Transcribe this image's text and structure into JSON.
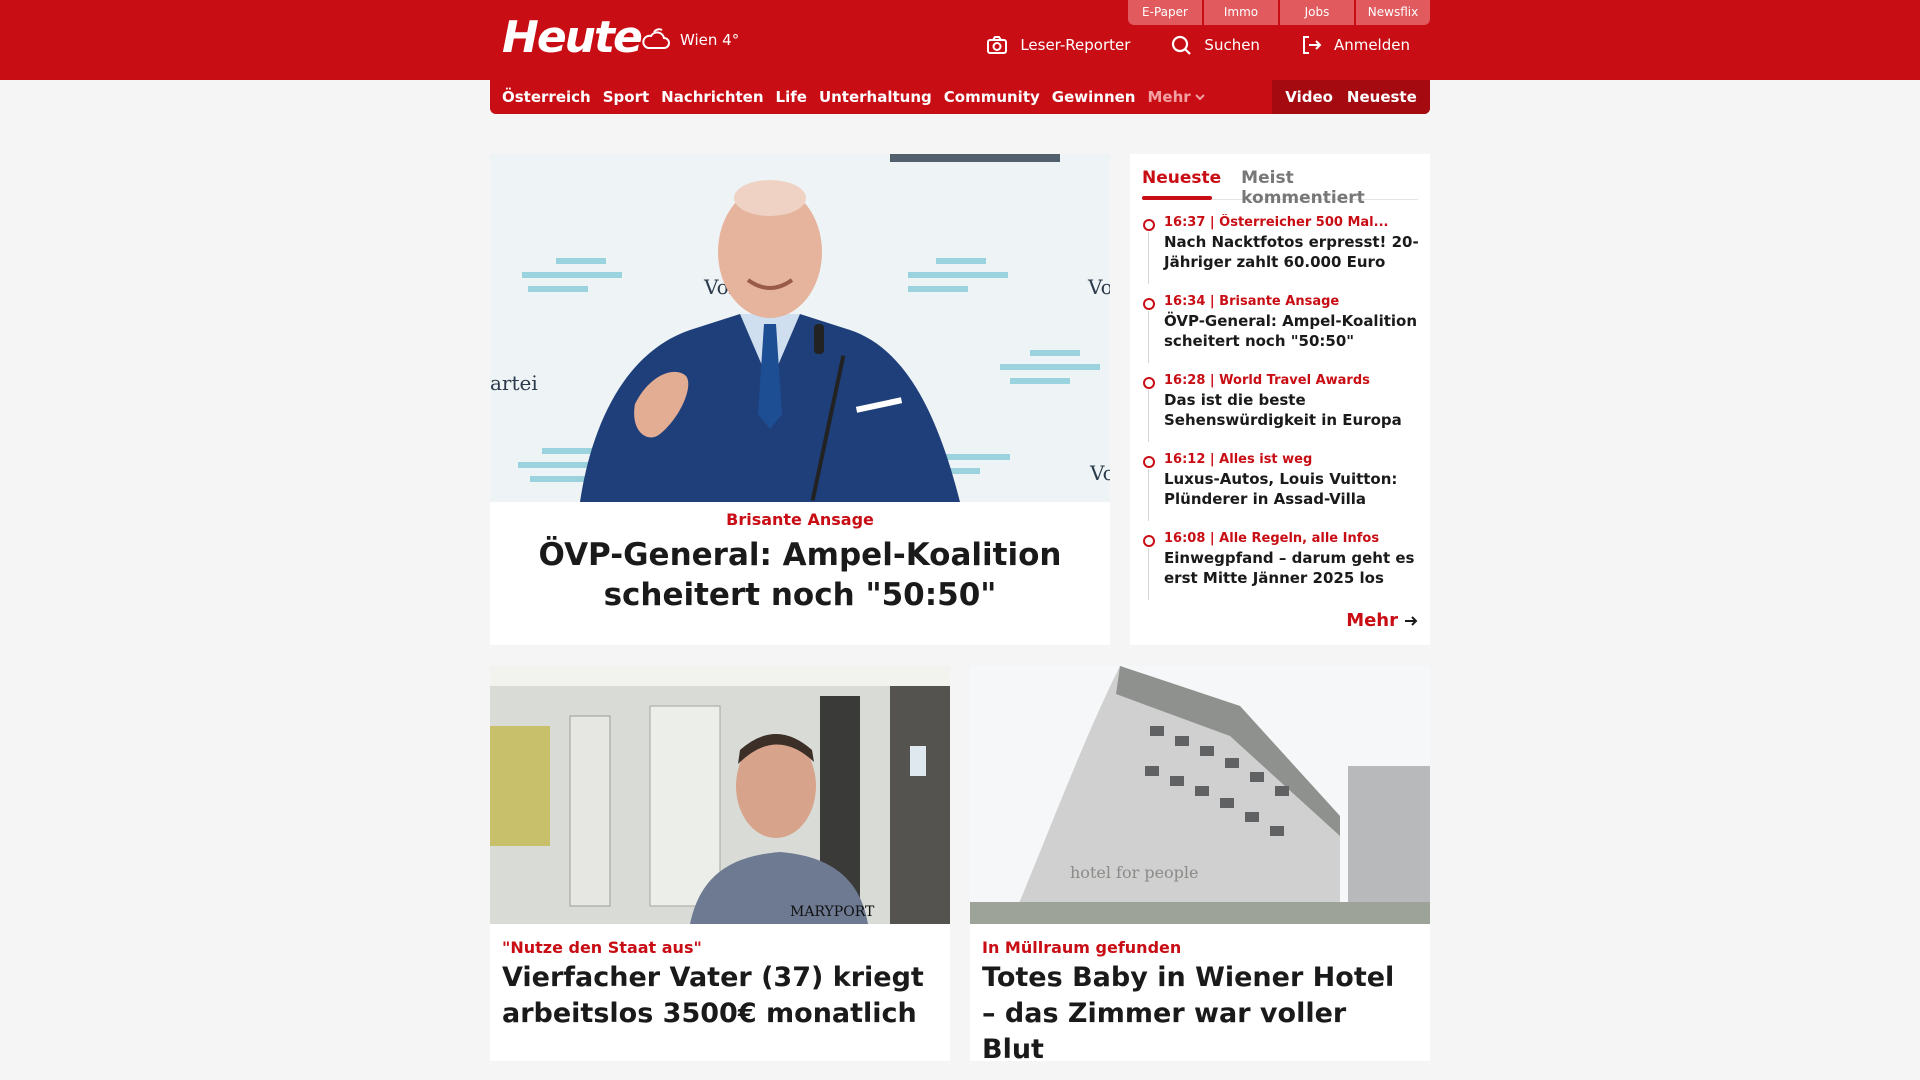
{
  "header": {
    "logo": "Heute",
    "weather": "Wien 4°",
    "top_links": [
      "E-Paper",
      "Immo",
      "Jobs",
      "Newsflix"
    ],
    "actions": {
      "reporter": "Leser-Reporter",
      "search": "Suchen",
      "login": "Anmelden"
    }
  },
  "nav": {
    "items": [
      "Österreich",
      "Sport",
      "Nachrichten",
      "Life",
      "Unterhaltung",
      "Community",
      "Gewinnen"
    ],
    "more": "Mehr",
    "video": "Video",
    "latest": "Neueste"
  },
  "hero": {
    "kicker": "Brisante Ansage",
    "title": "ÖVP-General: Ampel-Koalition scheitert noch \"50:50\""
  },
  "sidebar": {
    "tabs": [
      "Neueste",
      "Meist kommentiert"
    ],
    "items": [
      {
        "meta": "16:37 | Österreicher 500 Mal...",
        "title": "Nach Nacktfotos erpresst! 20-Jähriger zahlt 60.000 Euro"
      },
      {
        "meta": "16:34 | Brisante Ansage",
        "title": "ÖVP-General: Ampel-Koalition scheitert noch \"50:50\""
      },
      {
        "meta": "16:28 | World Travel Awards",
        "title": "Das ist die beste Sehenswürdigkeit in Europa"
      },
      {
        "meta": "16:12 | Alles ist weg",
        "title": "Luxus-Autos, Louis Vuitton: Plünderer in Assad-Villa"
      },
      {
        "meta": "16:08 | Alle Regeln, alle Infos",
        "title": "Einwegpfand – darum geht es erst Mitte Jänner 2025 los"
      }
    ],
    "more": "Mehr"
  },
  "cards": [
    {
      "kicker": "\"Nutze den Staat aus\"",
      "title": "Vierfacher Vater (37) kriegt arbeitslos 3500€ monatlich"
    },
    {
      "kicker": "In Müllraum gefunden",
      "title": "Totes Baby in Wiener Hotel – das Zimmer war voller Blut"
    }
  ],
  "colors": {
    "brand": "#c80d14",
    "brand_dark": "#a50a10"
  },
  "icons": [
    "weather-cloud-icon",
    "camera-icon",
    "search-icon",
    "login-icon",
    "chevron-down-icon",
    "arrow-right-icon"
  ]
}
